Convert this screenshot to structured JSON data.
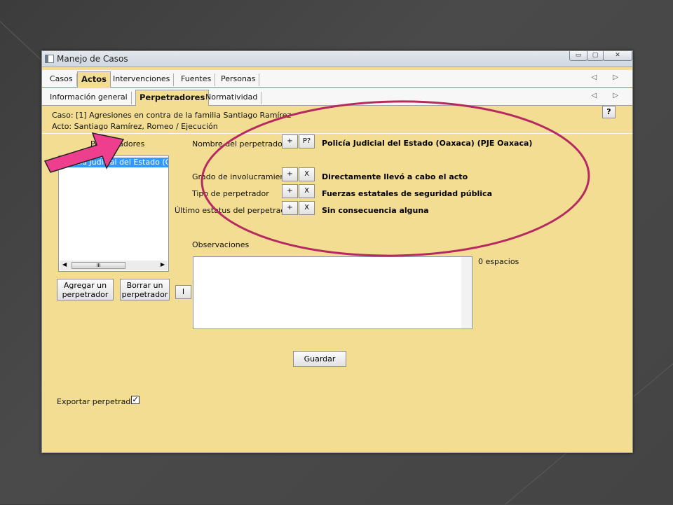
{
  "window": {
    "title": "Manejo de Casos",
    "controls": [
      "minimize-icon",
      "maximize-icon",
      "close-icon"
    ]
  },
  "tabs_primary": [
    "Casos",
    "Actos",
    "Intervenciones",
    "Fuentes",
    "Personas"
  ],
  "tabs_primary_active": "Actos",
  "tabs_secondary": [
    "Información general",
    "Perpetradores",
    "Normatividad"
  ],
  "tabs_secondary_active": "Perpetradores",
  "nav_arrows": "◁ ▷",
  "caso": "Caso: [1] Agresiones en contra de la familia Santiago Ramírez",
  "acto": "Acto: Santiago Ramírez, Romeo / Ejecución",
  "help_label": "?",
  "list": {
    "label": "Perpetradores",
    "selected_item": "Policía Judicial del Estado (Oaxaca) (PJE Oaxaca)",
    "scroll_thumb": "III"
  },
  "fields": {
    "nombre": {
      "label": "Nombre del perpetrador",
      "value": "Policía Judicial del Estado (Oaxaca) (PJE Oaxaca)",
      "btn1": "+",
      "btn2": "P?"
    },
    "grado": {
      "label": "Grado de involucramiento",
      "value": "Directamente llevó a cabo el acto",
      "btn1": "+",
      "btn2": "X"
    },
    "tipo": {
      "label": "Tipo de perpetrador",
      "value": "Fuerzas estatales de seguridad pública",
      "btn1": "+",
      "btn2": "X"
    },
    "estatus": {
      "label": "Último estatus del perpetrador",
      "value": "Sin consecuencia alguna",
      "btn1": "+",
      "btn2": "X"
    }
  },
  "observaciones": {
    "label": "Observaciones",
    "value": "",
    "counter": "0 espacios"
  },
  "buttons": {
    "agregar": "Agregar un perpetrador",
    "borrar": "Borrar un perpetrador",
    "i": "I",
    "guardar": "Guardar"
  },
  "exportar": {
    "label": "Exportar perpetrador",
    "checked": true
  },
  "annotation_colors": {
    "arrow": "#ee3f8f",
    "ellipse": "#b62a62"
  }
}
